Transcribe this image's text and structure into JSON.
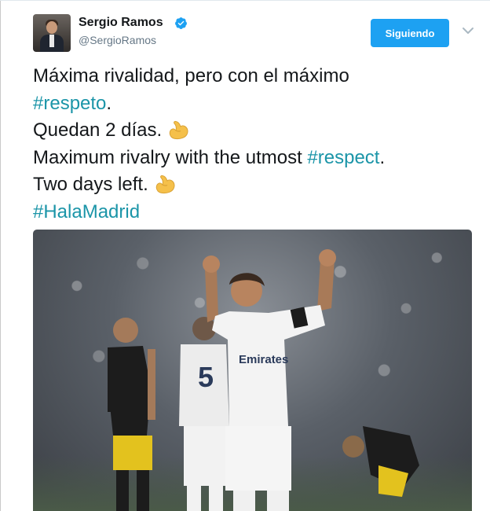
{
  "author": {
    "name": "Sergio Ramos",
    "handle": "@SergioRamos",
    "verified": true
  },
  "follow_button": {
    "label": "Siguiendo"
  },
  "tweet": {
    "line1": "Máxima rivalidad, pero con el máximo",
    "hashtag_respeto": "#respeto",
    "period1": ".",
    "line3": "Quedan 2 días.",
    "line4": "Maximum rivalry with the utmost",
    "hashtag_respect": "#respect",
    "period2": ".",
    "line5": "Two days left.",
    "hashtag_halamadrid": "#HalaMadrid"
  },
  "photo": {
    "kit_lettering": "Emirates",
    "shirt_number": "5"
  },
  "colors": {
    "hashtag": "#1b95a8",
    "follow_button_bg": "#1da1f2",
    "verified_badge": "#1da1f2",
    "handle_text": "#657786"
  },
  "icons": [
    "verified-badge-icon",
    "chevron-down-icon",
    "flexed-biceps-emoji"
  ]
}
